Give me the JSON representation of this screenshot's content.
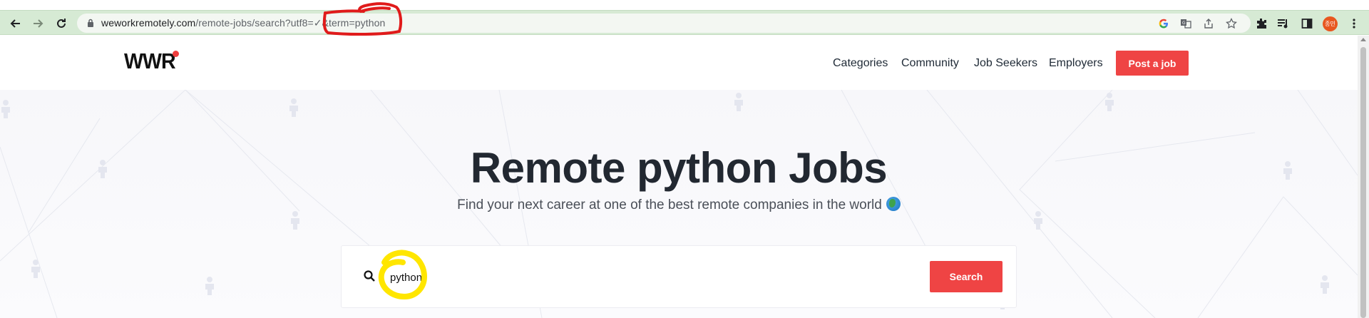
{
  "browser": {
    "url_host": "weworkremotely.com",
    "url_path": "/remote-jobs/search?utf8=✓&term=python",
    "profile_label": "종민"
  },
  "header": {
    "logo": "WWR",
    "nav": [
      "Categories",
      "Community",
      "Job Seekers",
      "Employers"
    ],
    "post_job_label": "Post a job"
  },
  "hero": {
    "title": "Remote python Jobs",
    "subtitle": "Find your next career at one of the best remote companies in the world"
  },
  "search": {
    "value": "python",
    "button_label": "Search"
  },
  "colors": {
    "accent": "#ef4444",
    "browser_bar": "#d6ead4",
    "annotation_red": "#e01b1b",
    "annotation_yellow": "#ffe600"
  },
  "icons": [
    "back-arrow-icon",
    "forward-arrow-icon",
    "reload-icon",
    "lock-icon",
    "google-icon",
    "translate-icon",
    "share-icon",
    "star-icon",
    "extensions-icon",
    "reading-list-icon",
    "side-panel-icon",
    "menu-icon",
    "search-icon",
    "globe-icon"
  ]
}
